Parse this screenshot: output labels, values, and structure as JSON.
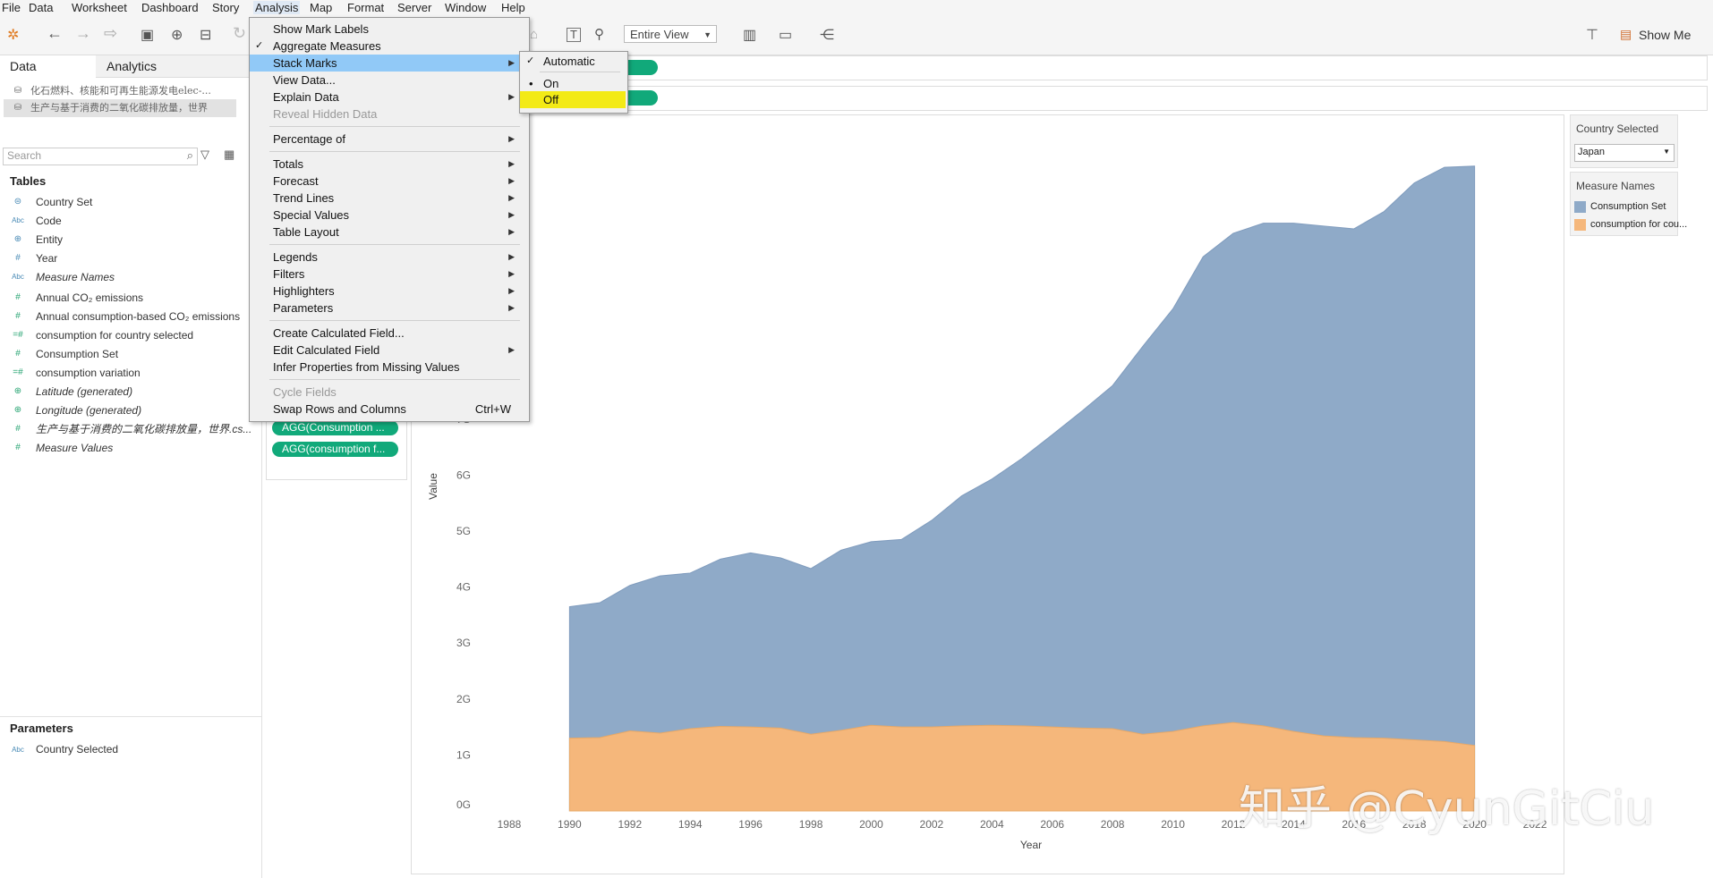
{
  "menubar": [
    "File",
    "Data",
    "Worksheet",
    "Dashboard",
    "Story",
    "Analysis",
    "Map",
    "Format",
    "Server",
    "Window",
    "Help"
  ],
  "toolbar": {
    "fit_select": "Entire View",
    "show_me": "Show Me"
  },
  "left_pane": {
    "tabs": [
      "Data",
      "Analytics"
    ],
    "datasources": [
      "化石燃料、核能和可再生能源发电elec-...",
      "生产与基于消费的二氧化碳排放量，世界"
    ],
    "search_placeholder": "Search",
    "tables_title": "Tables",
    "fields": [
      {
        "type": "set",
        "label": "Country Set",
        "icon": "set-icon"
      },
      {
        "type": "abc",
        "label": "Code",
        "icon": "abc-icon"
      },
      {
        "type": "geo",
        "label": "Entity",
        "icon": "globe-icon"
      },
      {
        "type": "num",
        "label": "Year",
        "icon": "hash-icon"
      },
      {
        "type": "abc",
        "label": "Measure Names",
        "icon": "abc-icon",
        "italic": true
      },
      {
        "type": "num",
        "label": "Annual CO₂ emissions",
        "icon": "hash-icon",
        "measure": true
      },
      {
        "type": "num",
        "label": "Annual consumption-based CO₂ emissions",
        "icon": "hash-icon",
        "measure": true
      },
      {
        "type": "calc",
        "label": "consumption for country selected",
        "icon": "calc-hash-icon",
        "measure": true
      },
      {
        "type": "num",
        "label": "Consumption Set",
        "icon": "hash-icon",
        "measure": true
      },
      {
        "type": "calc",
        "label": "consumption variation",
        "icon": "calc-hash-icon",
        "measure": true
      },
      {
        "type": "geo",
        "label": "Latitude (generated)",
        "icon": "globe-icon",
        "italic": true,
        "measure": true
      },
      {
        "type": "geo",
        "label": "Longitude (generated)",
        "icon": "globe-icon",
        "italic": true,
        "measure": true
      },
      {
        "type": "num",
        "label": "生产与基于消费的二氧化碳排放量，世界.cs...",
        "icon": "hash-icon",
        "italic": true,
        "measure": true
      },
      {
        "type": "num",
        "label": "Measure Values",
        "icon": "hash-icon",
        "italic": true,
        "measure": true
      }
    ],
    "parameters_title": "Parameters",
    "parameters": [
      {
        "label": "Country Selected",
        "icon": "abc-icon"
      }
    ]
  },
  "marks_pills": [
    "AGG(Consumption ...",
    "AGG(consumption f..."
  ],
  "analysis_menu": {
    "items": [
      {
        "label": "Show Mark Labels"
      },
      {
        "label": "Aggregate Measures",
        "checked": true
      },
      {
        "label": "Stack Marks",
        "submenu": true,
        "highlighted": true
      },
      {
        "label": "View Data..."
      },
      {
        "label": "Explain Data",
        "submenu": true
      },
      {
        "label": "Reveal Hidden Data",
        "disabled": true
      },
      {
        "sep": true
      },
      {
        "label": "Percentage of",
        "submenu": true
      },
      {
        "sep": true
      },
      {
        "label": "Totals",
        "submenu": true
      },
      {
        "label": "Forecast",
        "submenu": true
      },
      {
        "label": "Trend Lines",
        "submenu": true
      },
      {
        "label": "Special Values",
        "submenu": true
      },
      {
        "label": "Table Layout",
        "submenu": true
      },
      {
        "sep": true
      },
      {
        "label": "Legends",
        "submenu": true
      },
      {
        "label": "Filters",
        "submenu": true
      },
      {
        "label": "Highlighters",
        "submenu": true
      },
      {
        "label": "Parameters",
        "submenu": true
      },
      {
        "sep": true
      },
      {
        "label": "Create Calculated Field..."
      },
      {
        "label": "Edit Calculated Field",
        "submenu": true
      },
      {
        "label": "Infer Properties from Missing Values"
      },
      {
        "sep": true
      },
      {
        "label": "Cycle Fields",
        "disabled": true
      },
      {
        "label": "Swap Rows and Columns",
        "shortcut": "Ctrl+W"
      }
    ]
  },
  "stack_submenu": [
    {
      "label": "Automatic",
      "checked": true
    },
    {
      "label": "On",
      "bullet": true
    },
    {
      "label": "Off",
      "highlighted_yellow": true
    }
  ],
  "right_panel": {
    "country_title": "Country Selected",
    "country_value": "Japan",
    "legend_title": "Measure Names",
    "legend": [
      {
        "label": "Consumption Set",
        "color": "#8faac8"
      },
      {
        "label": "consumption for cou...",
        "color": "#f5b77b"
      }
    ]
  },
  "chart_data": {
    "type": "area",
    "xlabel": "Year",
    "ylabel": "Value",
    "x_ticks": [
      1988,
      1990,
      1992,
      1994,
      1996,
      1998,
      2000,
      2002,
      2004,
      2006,
      2008,
      2010,
      2012,
      2014,
      2016,
      2018,
      2020,
      2022
    ],
    "y_ticks": [
      "0G",
      "1G",
      "2G",
      "3G",
      "4G",
      "5G",
      "6G",
      "7G"
    ],
    "xlim": [
      1987.2,
      2022.8
    ],
    "ylim": [
      0,
      12.3
    ],
    "x": [
      1990,
      1991,
      1992,
      1993,
      1994,
      1995,
      1996,
      1997,
      1998,
      1999,
      2000,
      2001,
      2002,
      2003,
      2004,
      2005,
      2006,
      2007,
      2008,
      2009,
      2010,
      2011,
      2012,
      2013,
      2014,
      2015,
      2016,
      2017,
      2018,
      2019,
      2020
    ],
    "series": [
      {
        "name": "Consumption Set",
        "color": "#8faac8",
        "values": [
          3.65,
          3.72,
          4.03,
          4.2,
          4.25,
          4.5,
          4.61,
          4.52,
          4.33,
          4.66,
          4.81,
          4.85,
          5.19,
          5.63,
          5.93,
          6.3,
          6.72,
          7.15,
          7.6,
          8.3,
          8.97,
          9.9,
          10.32,
          10.5,
          10.5,
          10.45,
          10.4,
          10.71,
          11.22,
          11.5,
          11.52
        ]
      },
      {
        "name": "consumption for cou...",
        "color": "#f5b77b",
        "values": [
          1.3,
          1.31,
          1.43,
          1.39,
          1.47,
          1.51,
          1.5,
          1.48,
          1.37,
          1.44,
          1.53,
          1.5,
          1.5,
          1.52,
          1.53,
          1.52,
          1.5,
          1.48,
          1.47,
          1.37,
          1.42,
          1.52,
          1.58,
          1.52,
          1.42,
          1.34,
          1.31,
          1.3,
          1.27,
          1.24,
          1.17
        ]
      }
    ]
  },
  "watermark": "知乎 @CyunGitCiu"
}
